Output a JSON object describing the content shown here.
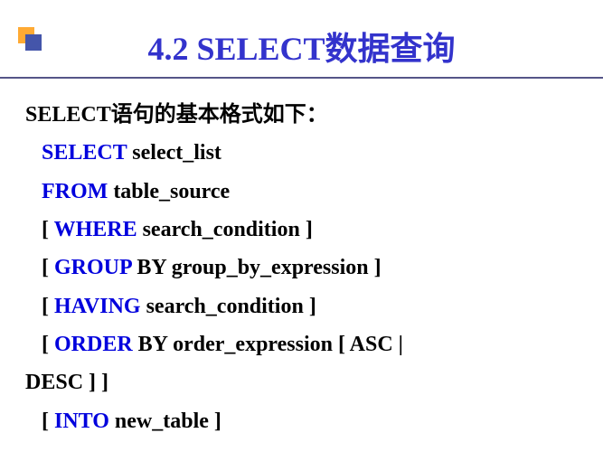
{
  "title": "4.2  SELECT数据查询",
  "intro": "SELECT语句的基本格式如下：",
  "lines": {
    "select": {
      "kw": "SELECT",
      "rest": " select_list"
    },
    "from": {
      "kw": "FROM",
      "rest": " table_source"
    },
    "where": {
      "pre": "[ ",
      "kw": "WHERE",
      "rest": " search_condition ]"
    },
    "group": {
      "pre": "[ ",
      "kw": "GROUP",
      "rest": " BY group_by_expression ]"
    },
    "having": {
      "pre": "[ ",
      "kw": "HAVING",
      "rest": " search_condition ]"
    },
    "order": {
      "pre": " [ ",
      "kw": "ORDER",
      "rest": " BY order_expression [ ASC | "
    },
    "order_cont": "DESC ] ]",
    "into": {
      "pre": " [ ",
      "kw": "INTO",
      "rest": " new_table ]"
    }
  }
}
